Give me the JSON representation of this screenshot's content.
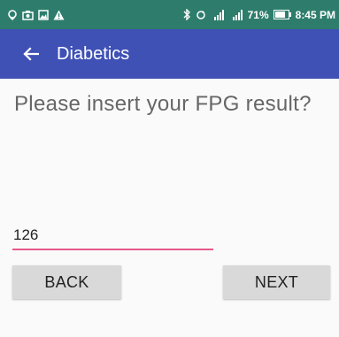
{
  "colors": {
    "status_bar": "#2e7d6c",
    "app_bar": "#3f51b5",
    "input_underline": "#e8588a",
    "button_bg": "#d9d9d9"
  },
  "status_bar": {
    "left_icons": [
      "location-icon",
      "camera-icon",
      "gallery-icon",
      "warning-icon"
    ],
    "right_icons": [
      "bluetooth-icon",
      "sync-icon",
      "signal-icon-1",
      "signal-icon-2",
      "battery-icon"
    ],
    "battery": "71%",
    "time": "8:45 PM"
  },
  "app_bar": {
    "back_icon": "arrow-back-icon",
    "title": "Diabetics"
  },
  "form": {
    "question": "Please insert your FPG result?",
    "fpg_value": "126",
    "back_label": "BACK",
    "next_label": "NEXT"
  }
}
